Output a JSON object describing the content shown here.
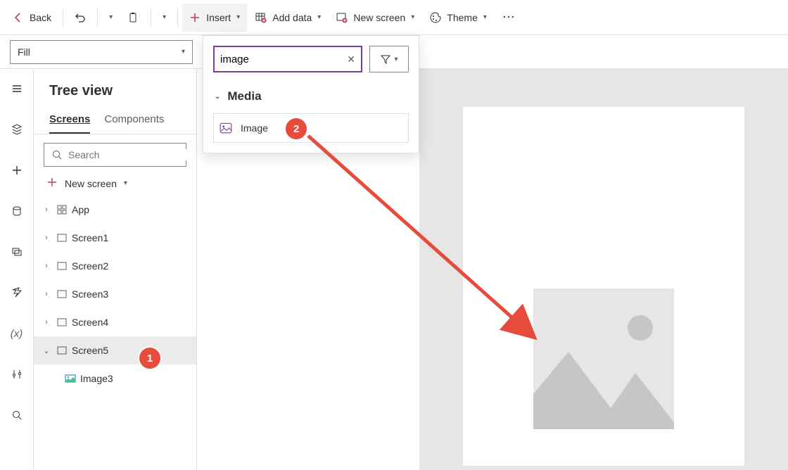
{
  "toolbar": {
    "back": "Back",
    "insert": "Insert",
    "add_data": "Add data",
    "new_screen": "New screen",
    "theme": "Theme"
  },
  "property": {
    "selected": "Fill"
  },
  "tree": {
    "title": "Tree view",
    "tabs": {
      "screens": "Screens",
      "components": "Components"
    },
    "search_placeholder": "Search",
    "new_screen": "New screen",
    "items": [
      {
        "label": "App",
        "type": "app"
      },
      {
        "label": "Screen1",
        "type": "screen"
      },
      {
        "label": "Screen2",
        "type": "screen"
      },
      {
        "label": "Screen3",
        "type": "screen"
      },
      {
        "label": "Screen4",
        "type": "screen"
      },
      {
        "label": "Screen5",
        "type": "screen",
        "selected": true,
        "expanded": true
      },
      {
        "label": "Image3",
        "type": "image",
        "child": true
      }
    ]
  },
  "insert_panel": {
    "search_value": "image",
    "group": "Media",
    "item": "Image"
  },
  "badges": {
    "one": "1",
    "two": "2"
  }
}
